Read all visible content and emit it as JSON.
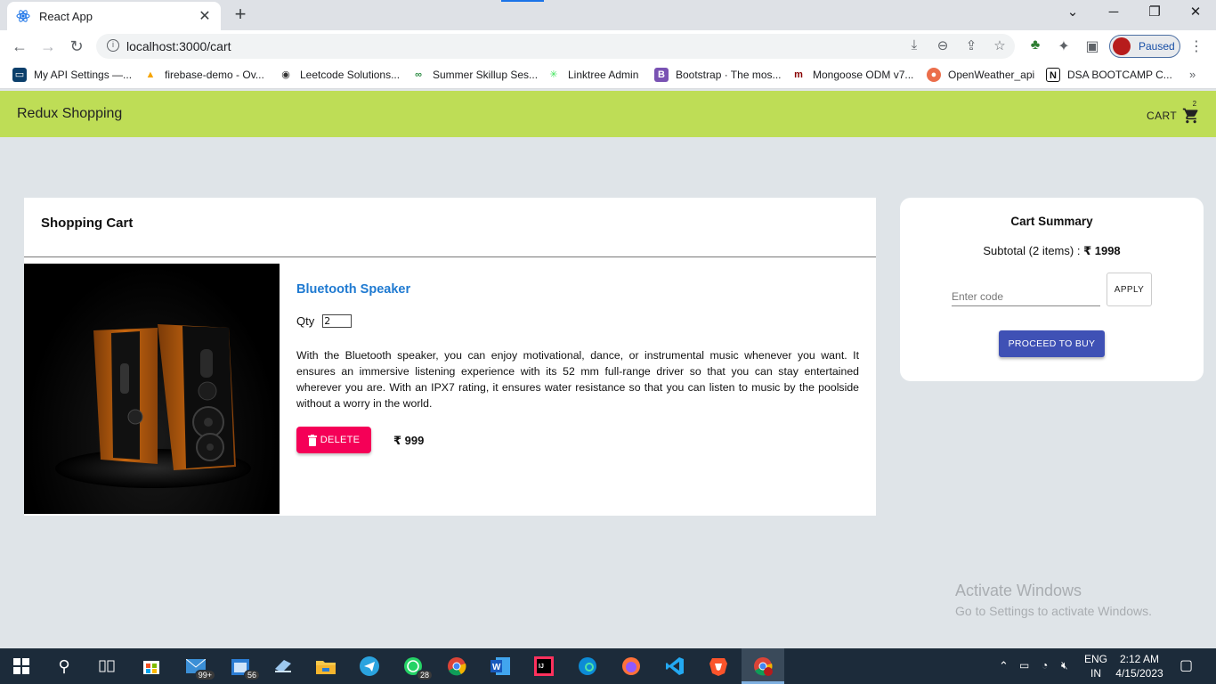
{
  "browser": {
    "tab_title": "React App",
    "tab_close": "✕",
    "new_tab": "+",
    "url": "localhost:3000/cart",
    "profile_status": "Paused",
    "window_controls": {
      "chevron": "⌄",
      "minimize": "─",
      "restore": "❐",
      "close": "✕"
    },
    "bookmarks": [
      {
        "label": "My API Settings —...",
        "icon": "api-icon",
        "color": "#0b3f6b"
      },
      {
        "label": "firebase-demo - Ov...",
        "icon": "firebase-icon",
        "color": "#f6a400"
      },
      {
        "label": "Leetcode Solutions...",
        "icon": "github-icon",
        "color": "#333333"
      },
      {
        "label": "Summer Skillup Ses...",
        "icon": "gfg-icon",
        "color": "#2f8d46"
      },
      {
        "label": "Linktree Admin",
        "icon": "linktree-icon",
        "color": "#43e55e"
      },
      {
        "label": "Bootstrap · The mos...",
        "icon": "bootstrap-icon",
        "color": "#7952b3"
      },
      {
        "label": "Mongoose ODM v7...",
        "icon": "mongoose-icon",
        "color": "#880000"
      },
      {
        "label": "OpenWeather_api",
        "icon": "openweather-icon",
        "color": "#eb6e4b"
      },
      {
        "label": "DSA BOOTCAMP C...",
        "icon": "notion-icon",
        "color": "#111111"
      }
    ],
    "bookmarks_more": "»"
  },
  "app": {
    "title": "Redux Shopping",
    "cart_label": "CART",
    "cart_count": "2"
  },
  "cart": {
    "heading": "Shopping Cart",
    "items": [
      {
        "name": "Bluetooth Speaker",
        "qty_label": "Qty",
        "qty": "2",
        "description": "With the Bluetooth speaker, you can enjoy motivational, dance, or instrumental music whenever you want. It ensures an immersive listening experience with its 52 mm full-range driver so that you can stay entertained wherever you are. With an IPX7 rating, it ensures water resistance so that you can listen to music by the poolside without a worry in the world.",
        "delete_label": "DELETE",
        "price": "₹ 999"
      }
    ]
  },
  "summary": {
    "title": "Cart Summary",
    "subtotal_label": "Subtotal (2 items) :",
    "subtotal_value": "₹ 1998",
    "code_placeholder": "Enter code",
    "apply_label": "APPLY",
    "buy_label": "PROCEED TO BUY"
  },
  "watermark": {
    "title": "Activate Windows",
    "subtitle": "Go to Settings to activate Windows."
  },
  "taskbar": {
    "mail_badge": "99+",
    "store_badge": "56",
    "whatsapp_badge": "28",
    "lang_top": "ENG",
    "lang_bottom": "IN",
    "time": "2:12 AM",
    "date": "4/15/2023"
  },
  "colors": {
    "appbar": "#bedd56",
    "link": "#1f7ad1",
    "delete": "#f50057",
    "primary": "#3f51b5",
    "page_bg": "#dfe4e8"
  }
}
